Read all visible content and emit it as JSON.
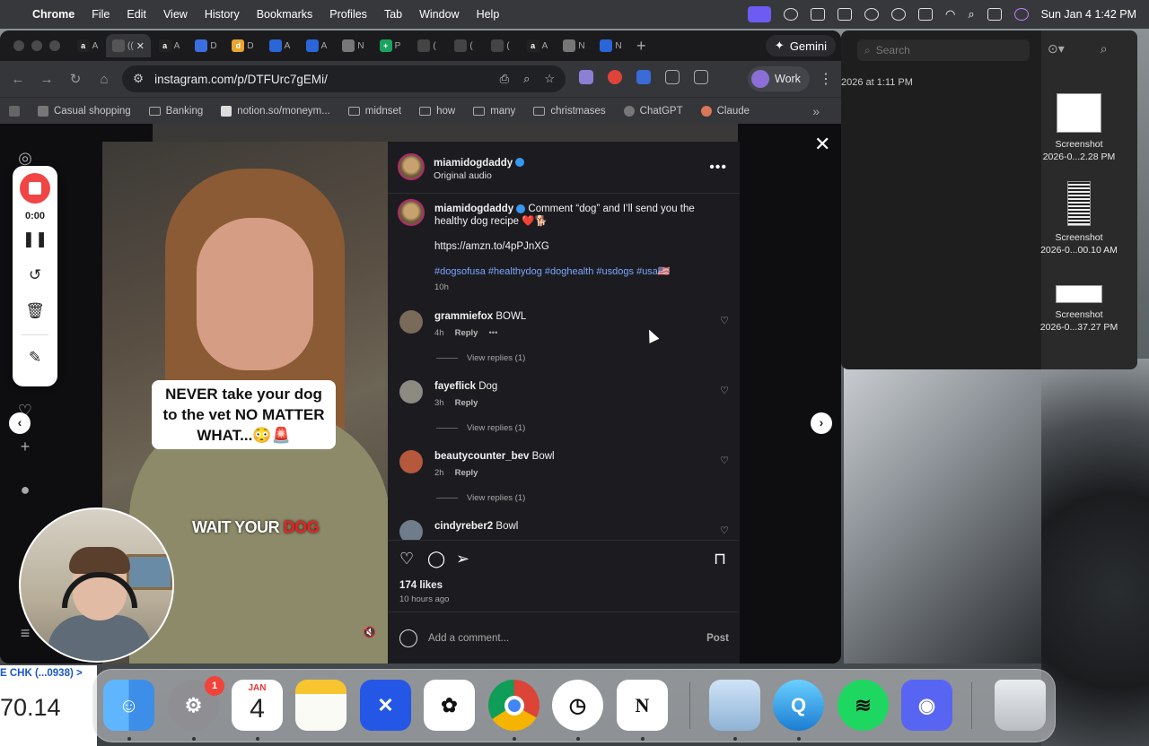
{
  "menubar": {
    "app": "Chrome",
    "items": [
      "File",
      "Edit",
      "View",
      "History",
      "Bookmarks",
      "Profiles",
      "Tab",
      "Window",
      "Help"
    ],
    "datetime": "Sun Jan 4  1:42 PM"
  },
  "browser": {
    "gemini_label": "Gemini",
    "url": "instagram.com/p/DTFUrc7gEMi/",
    "profile_label": "Work",
    "tabs": [
      {
        "letter": "a",
        "label": "A",
        "color": "#222"
      },
      {
        "letter": "",
        "label": "((",
        "color": "#555",
        "active": true
      },
      {
        "letter": "a",
        "label": "A",
        "color": "#222"
      },
      {
        "letter": "",
        "label": "D",
        "color": "#3b6fe0"
      },
      {
        "letter": "d",
        "label": "D",
        "color": "#e8a530"
      },
      {
        "letter": "",
        "label": "A",
        "color": "#2a66d8"
      },
      {
        "letter": "",
        "label": "A",
        "color": "#2a66d8"
      },
      {
        "letter": "",
        "label": "N",
        "color": "#777"
      },
      {
        "letter": "+",
        "label": "P",
        "color": "#1aa260"
      },
      {
        "letter": "",
        "label": "(",
        "color": "#444"
      },
      {
        "letter": "",
        "label": "(",
        "color": "#444"
      },
      {
        "letter": "",
        "label": "(",
        "color": "#444"
      },
      {
        "letter": "a",
        "label": "A",
        "color": "#222"
      },
      {
        "letter": "",
        "label": "N",
        "color": "#777"
      },
      {
        "letter": "",
        "label": "N",
        "color": "#2a66d8"
      }
    ],
    "bookmarks": [
      "Casual shopping",
      "Banking",
      "notion.so/moneym...",
      "midnset",
      "how",
      "many",
      "christmases",
      "ChatGPT",
      "Claude"
    ]
  },
  "finder": {
    "search_placeholder": "Search",
    "date_fragment": "2026 at 1:11 PM",
    "files": [
      {
        "line1": "Screenshot",
        "line2": "2026-0...2.28 PM"
      },
      {
        "line1": "Screenshot",
        "line2": "2026-0...00.10 AM"
      },
      {
        "line1": "Screenshot",
        "line2": "2026-0...37.27 PM"
      }
    ]
  },
  "post": {
    "author": "miamidogdaddy",
    "audio": "Original audio",
    "caption": "Comment “dog” and I’ll send you the healthy dog recipe ❤️🐕",
    "link": "https://amzn.to/4pPJnXG",
    "hashtags": "#dogsofusa #healthydog #doghealth #usdogs #usa🇺🇸",
    "caption_age": "10h",
    "likes": "174 likes",
    "posted": "10 hours ago",
    "comment_placeholder": "Add a comment...",
    "post_label": "Post",
    "video_caption": "NEVER take your dog to the vet NO MATTER WHAT...😳🚨",
    "video_sub_white": "WAIT YOUR ",
    "video_sub_red": "DOG",
    "comments": [
      {
        "user": "grammiefox",
        "text": "BOWL",
        "age": "4h",
        "reply": "Reply",
        "view_replies": "View replies (1)",
        "color": "#7a6a5a"
      },
      {
        "user": "fayeflick",
        "text": "Dog",
        "age": "3h",
        "reply": "Reply",
        "view_replies": "View replies (1)",
        "color": "#8d8a82"
      },
      {
        "user": "beautycounter_bev",
        "text": "Bowl",
        "age": "2h",
        "reply": "Reply",
        "view_replies": "View replies (1)",
        "color": "#b5583b"
      },
      {
        "user": "cindyreber2",
        "text": "Bowl",
        "age": "",
        "reply": "",
        "view_replies": "",
        "color": "#6f7d8a"
      }
    ]
  },
  "recorder": {
    "time": "0:00"
  },
  "bank": {
    "account": "E CHK (...0938)  >",
    "amount": "70.14"
  },
  "dock": {
    "calendar_month": "JAN",
    "calendar_day": "4",
    "settings_badge": "1"
  },
  "colors": {
    "recording_red": "#f04545",
    "hashtag_blue": "#7aa5ff",
    "instagram_panel": "#1c1c20"
  }
}
